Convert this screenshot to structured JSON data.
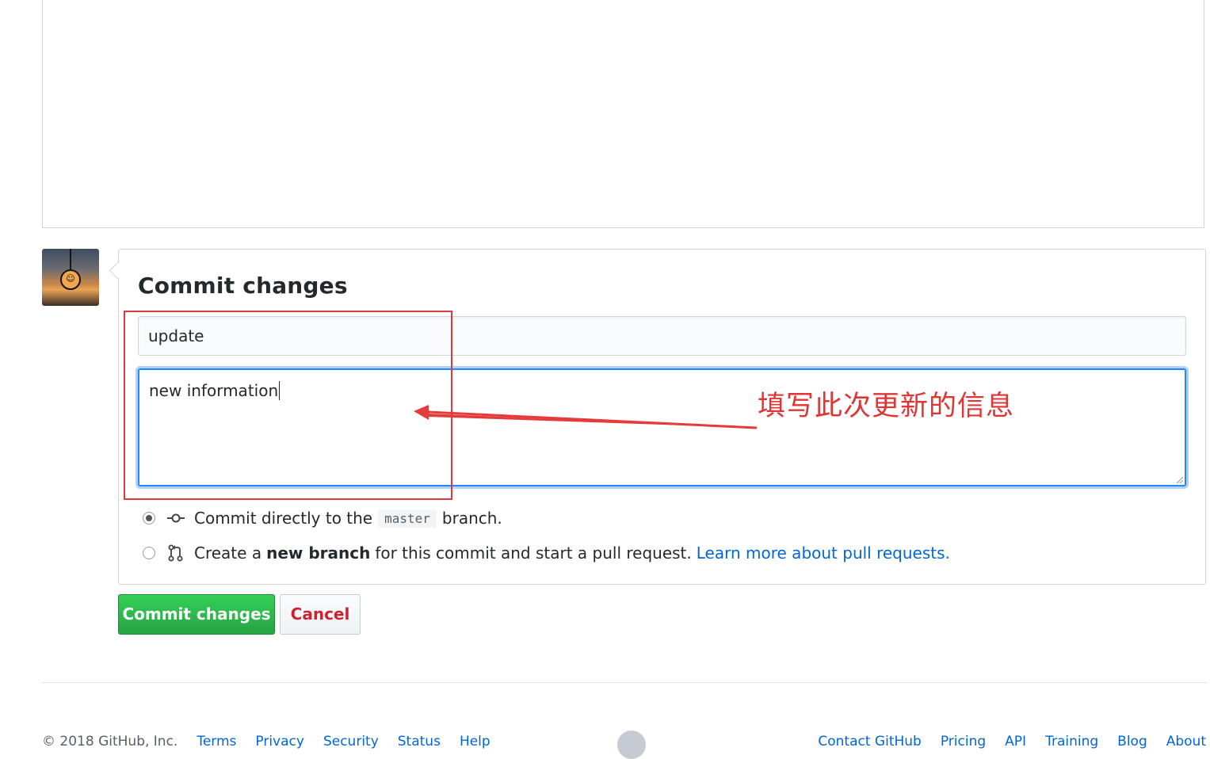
{
  "commit_form": {
    "title": "Commit changes",
    "summary_value": "update",
    "description_value": "new information",
    "option_direct": {
      "prefix": "Commit directly to the",
      "branch": "master",
      "suffix": "branch."
    },
    "option_new_branch": {
      "prefix": "Create a",
      "bold": "new branch",
      "middle": "for this commit and start a pull request.",
      "link": "Learn more about pull requests."
    },
    "commit_button": "Commit changes",
    "cancel_button": "Cancel"
  },
  "annotation": {
    "text": "填写此次更新的信息",
    "color": "#e03535"
  },
  "footer": {
    "copyright": "© 2018 GitHub, Inc.",
    "left_links": [
      "Terms",
      "Privacy",
      "Security",
      "Status",
      "Help"
    ],
    "right_links": [
      "Contact GitHub",
      "Pricing",
      "API",
      "Training",
      "Blog",
      "About"
    ],
    "logo_icon": "github-octocat-icon"
  },
  "colors": {
    "primary_button": "#28a745",
    "link": "#0366d6",
    "cancel": "#cb2431",
    "focus_border": "#2188ff"
  }
}
